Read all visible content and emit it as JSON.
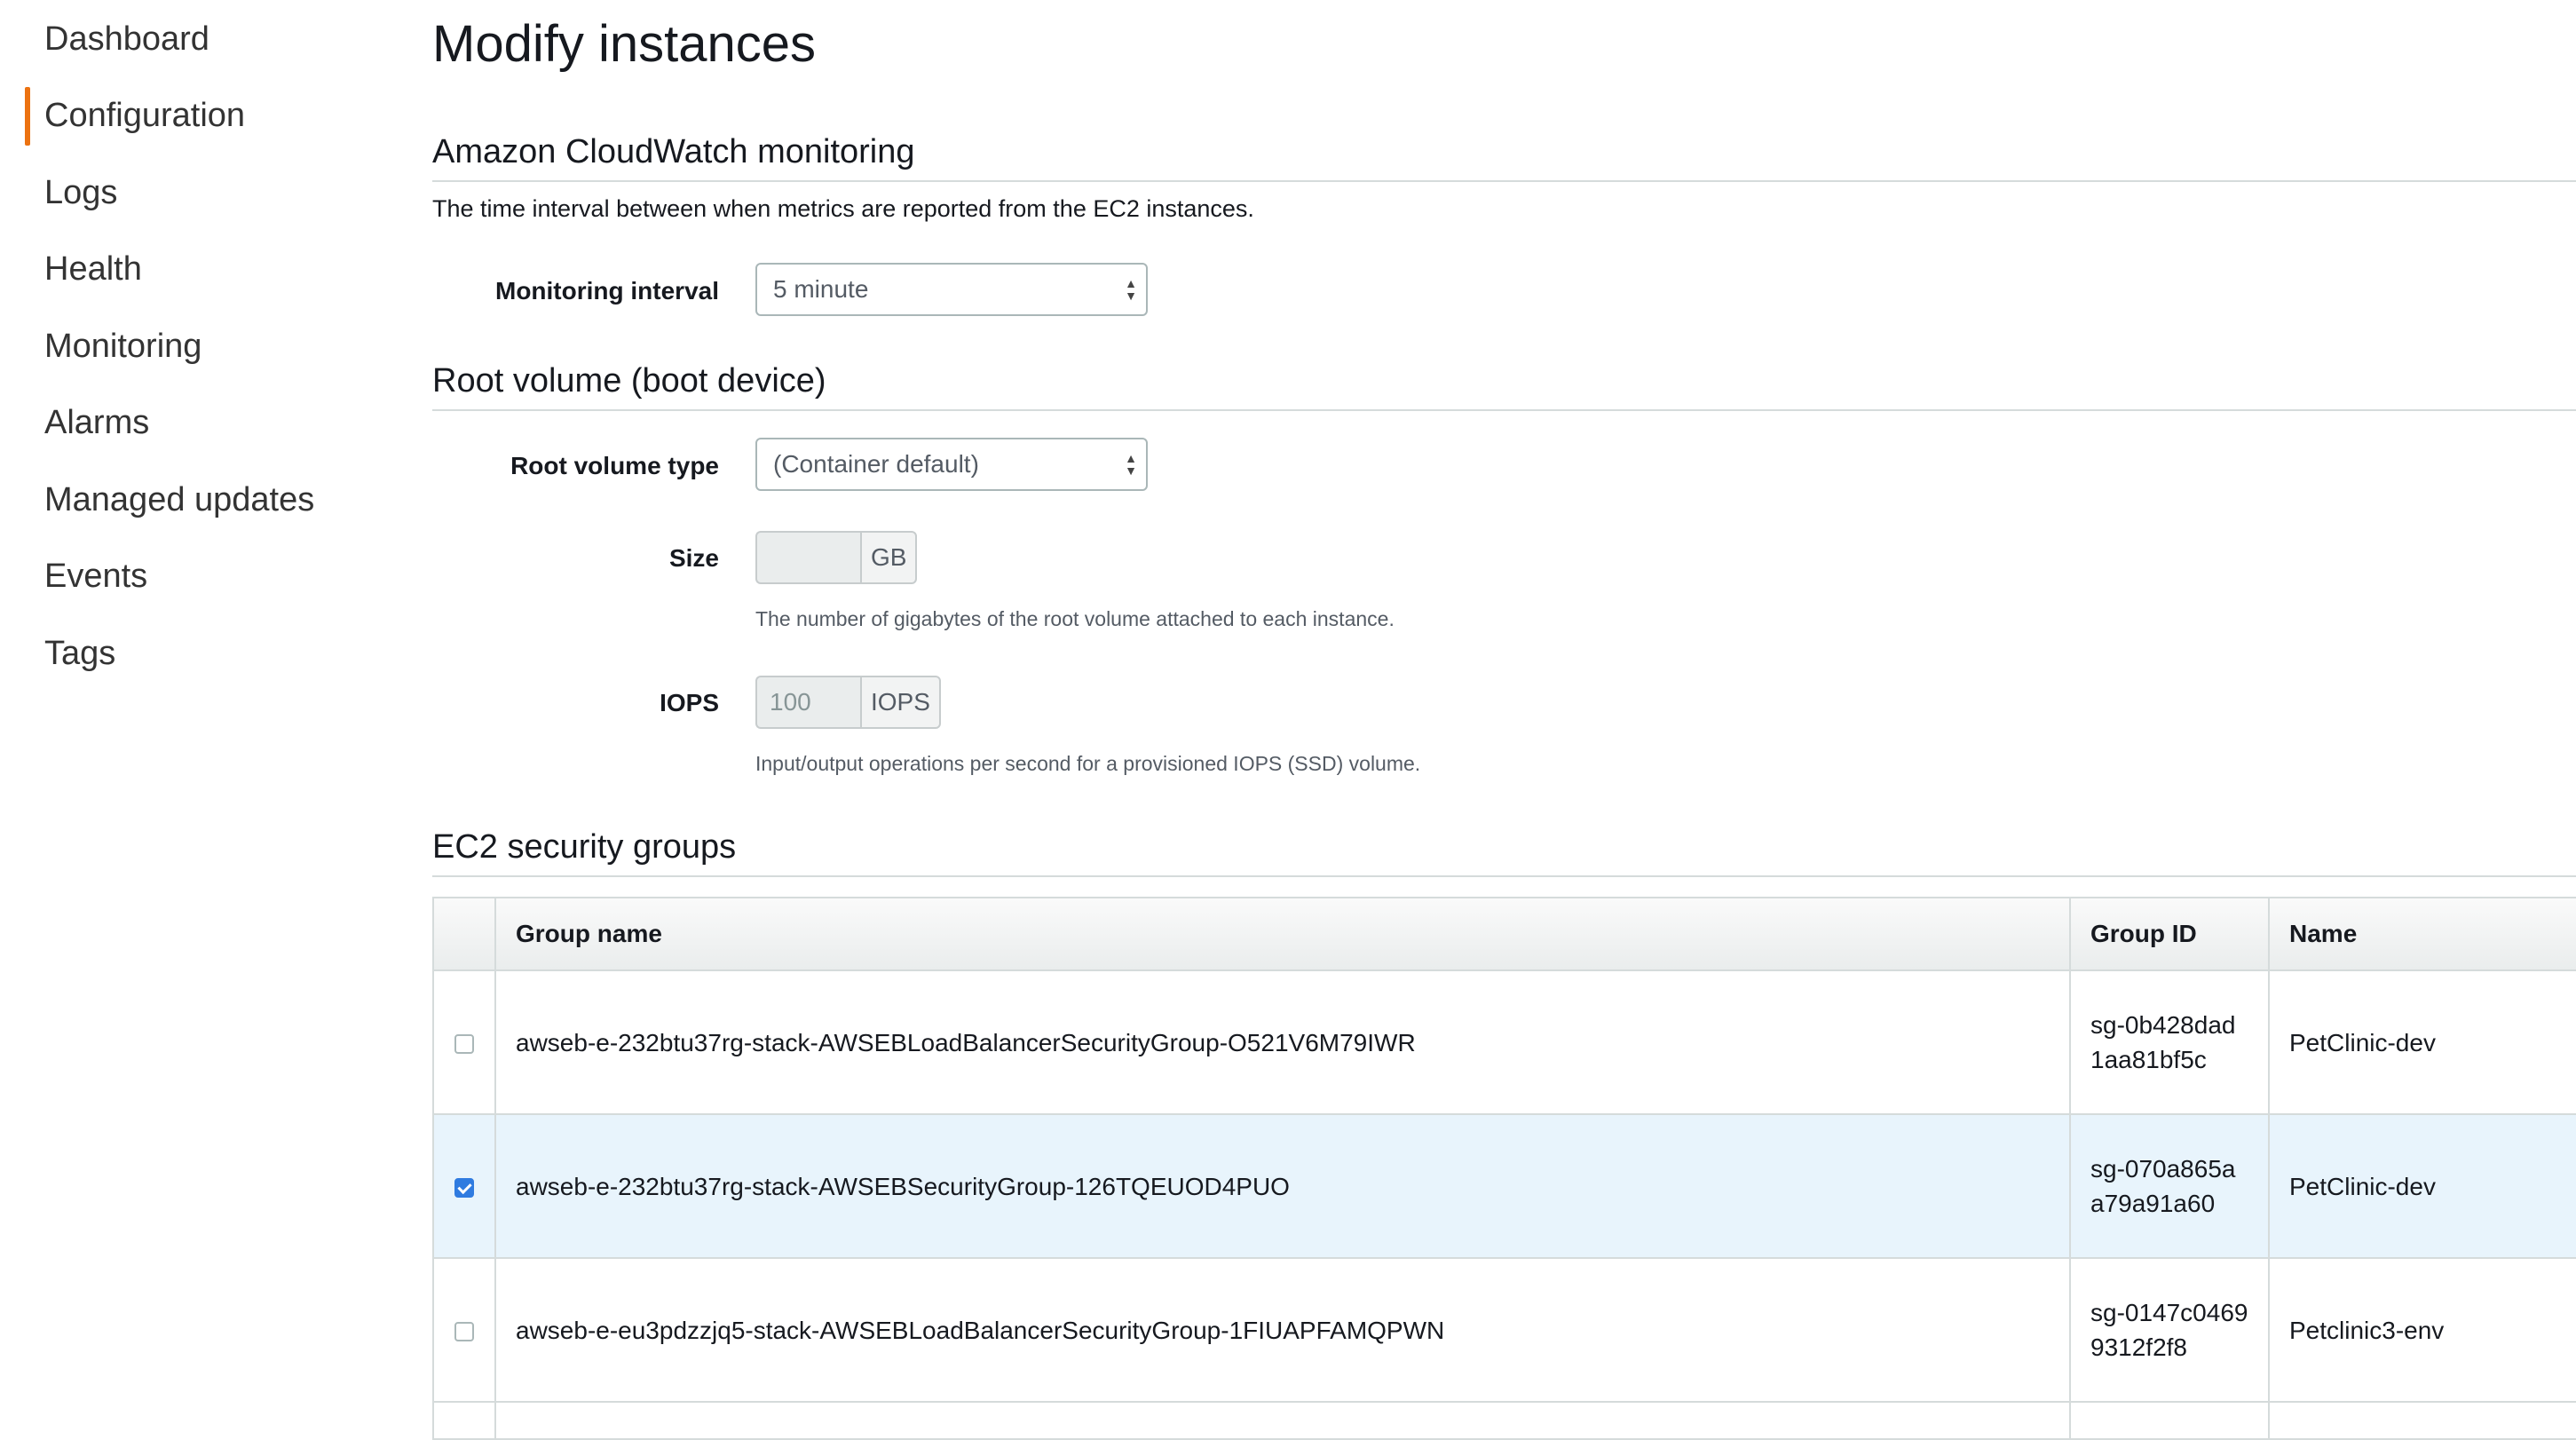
{
  "sidebar": {
    "items": [
      {
        "label": "Dashboard"
      },
      {
        "label": "Configuration",
        "active": true
      },
      {
        "label": "Logs"
      },
      {
        "label": "Health"
      },
      {
        "label": "Monitoring"
      },
      {
        "label": "Alarms"
      },
      {
        "label": "Managed updates"
      },
      {
        "label": "Events"
      },
      {
        "label": "Tags"
      }
    ],
    "active_accent": "#ec7211"
  },
  "page": {
    "title": "Modify instances"
  },
  "cloudwatch": {
    "title": "Amazon CloudWatch monitoring",
    "description": "The time interval between when metrics are reported from the EC2 instances.",
    "interval_label": "Monitoring interval",
    "interval_value": "5 minute"
  },
  "root_volume": {
    "title": "Root volume (boot device)",
    "type_label": "Root volume type",
    "type_value": "(Container default)",
    "size_label": "Size",
    "size_value": "",
    "size_unit": "GB",
    "size_hint": "The number of gigabytes of the root volume attached to each instance.",
    "iops_label": "IOPS",
    "iops_placeholder": "100",
    "iops_unit": "IOPS",
    "iops_hint": "Input/output operations per second for a provisioned IOPS (SSD) volume."
  },
  "security_groups": {
    "title": "EC2 security groups",
    "columns": [
      "Group name",
      "Group ID",
      "Name"
    ],
    "rows": [
      {
        "checked": false,
        "group_name": "awseb-e-232btu37rg-stack-AWSEBLoadBalancerSecurityGroup-O521V6M79IWR",
        "group_id": "sg-0b428dad1aa81bf5c",
        "name": "PetClinic-dev"
      },
      {
        "checked": true,
        "group_name": "awseb-e-232btu37rg-stack-AWSEBSecurityGroup-126TQEUOD4PUO",
        "group_id": "sg-070a865aa79a91a60",
        "name": "PetClinic-dev"
      },
      {
        "checked": false,
        "group_name": "awseb-e-eu3pdzzjq5-stack-AWSEBLoadBalancerSecurityGroup-1FIUAPFAMQPWN",
        "group_id": "sg-0147c04699312f2f8",
        "name": "Petclinic3-env"
      }
    ],
    "selected_row_color": "#e8f4fc",
    "checkbox_color": "#2f7be0"
  }
}
